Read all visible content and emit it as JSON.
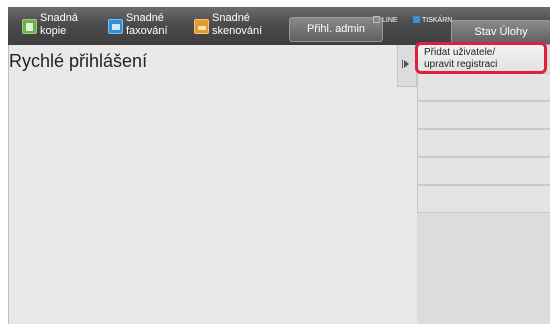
{
  "topbar": {
    "modes": [
      {
        "label": "Snadná\nkopie",
        "icon": "copy-icon"
      },
      {
        "label": "Snadné\nfaxování",
        "icon": "fax-icon"
      },
      {
        "label": "Snadné\nskenování",
        "icon": "scan-icon"
      }
    ],
    "admin_login": "Přihl. admin",
    "status_line": "LINE",
    "status_print": "TISKÁRN",
    "job_status": "Stav Úlohy"
  },
  "main": {
    "title": "Rychlé přihlášení"
  },
  "side_panel": {
    "items": [
      {
        "label": "Přidat uživatele/\nupravit registraci"
      }
    ]
  },
  "colors": {
    "accent_highlight": "#e0203a",
    "print_indicator": "#3a8fd6"
  }
}
